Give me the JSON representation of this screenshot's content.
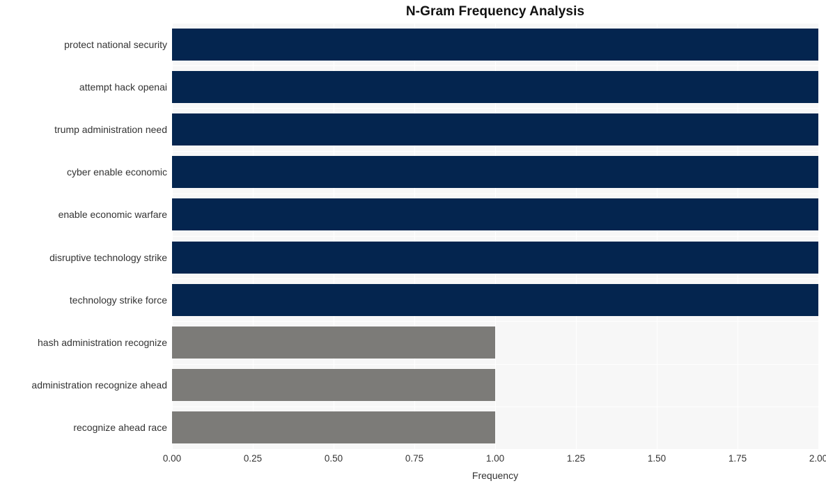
{
  "chart_data": {
    "type": "bar",
    "orientation": "horizontal",
    "title": "N-Gram Frequency Analysis",
    "xlabel": "Frequency",
    "ylabel": "",
    "xlim": [
      0.0,
      2.0
    ],
    "xticks": [
      "0.00",
      "0.25",
      "0.50",
      "0.75",
      "1.00",
      "1.25",
      "1.50",
      "1.75",
      "2.00"
    ],
    "xtick_values": [
      0.0,
      0.25,
      0.5,
      0.75,
      1.0,
      1.25,
      1.5,
      1.75,
      2.0
    ],
    "grid": true,
    "legend": "none",
    "categories": [
      "protect national security",
      "attempt hack openai",
      "trump administration need",
      "cyber enable economic",
      "enable economic warfare",
      "disruptive technology strike",
      "technology strike force",
      "hash administration recognize",
      "administration recognize ahead",
      "recognize ahead race"
    ],
    "values": [
      2,
      2,
      2,
      2,
      2,
      2,
      2,
      1,
      1,
      1
    ],
    "bar_colors": [
      "#04254f",
      "#04254f",
      "#04254f",
      "#04254f",
      "#04254f",
      "#04254f",
      "#04254f",
      "#7c7b78",
      "#7c7b78",
      "#7c7b78"
    ]
  },
  "style": {
    "plot_background": "#f7f7f7",
    "page_background": "#ffffff",
    "gridline_color": "#ffffff",
    "primary_bar_color": "#04254f",
    "secondary_bar_color": "#7c7b78",
    "text_color": "#333333",
    "title_color": "#111111"
  }
}
